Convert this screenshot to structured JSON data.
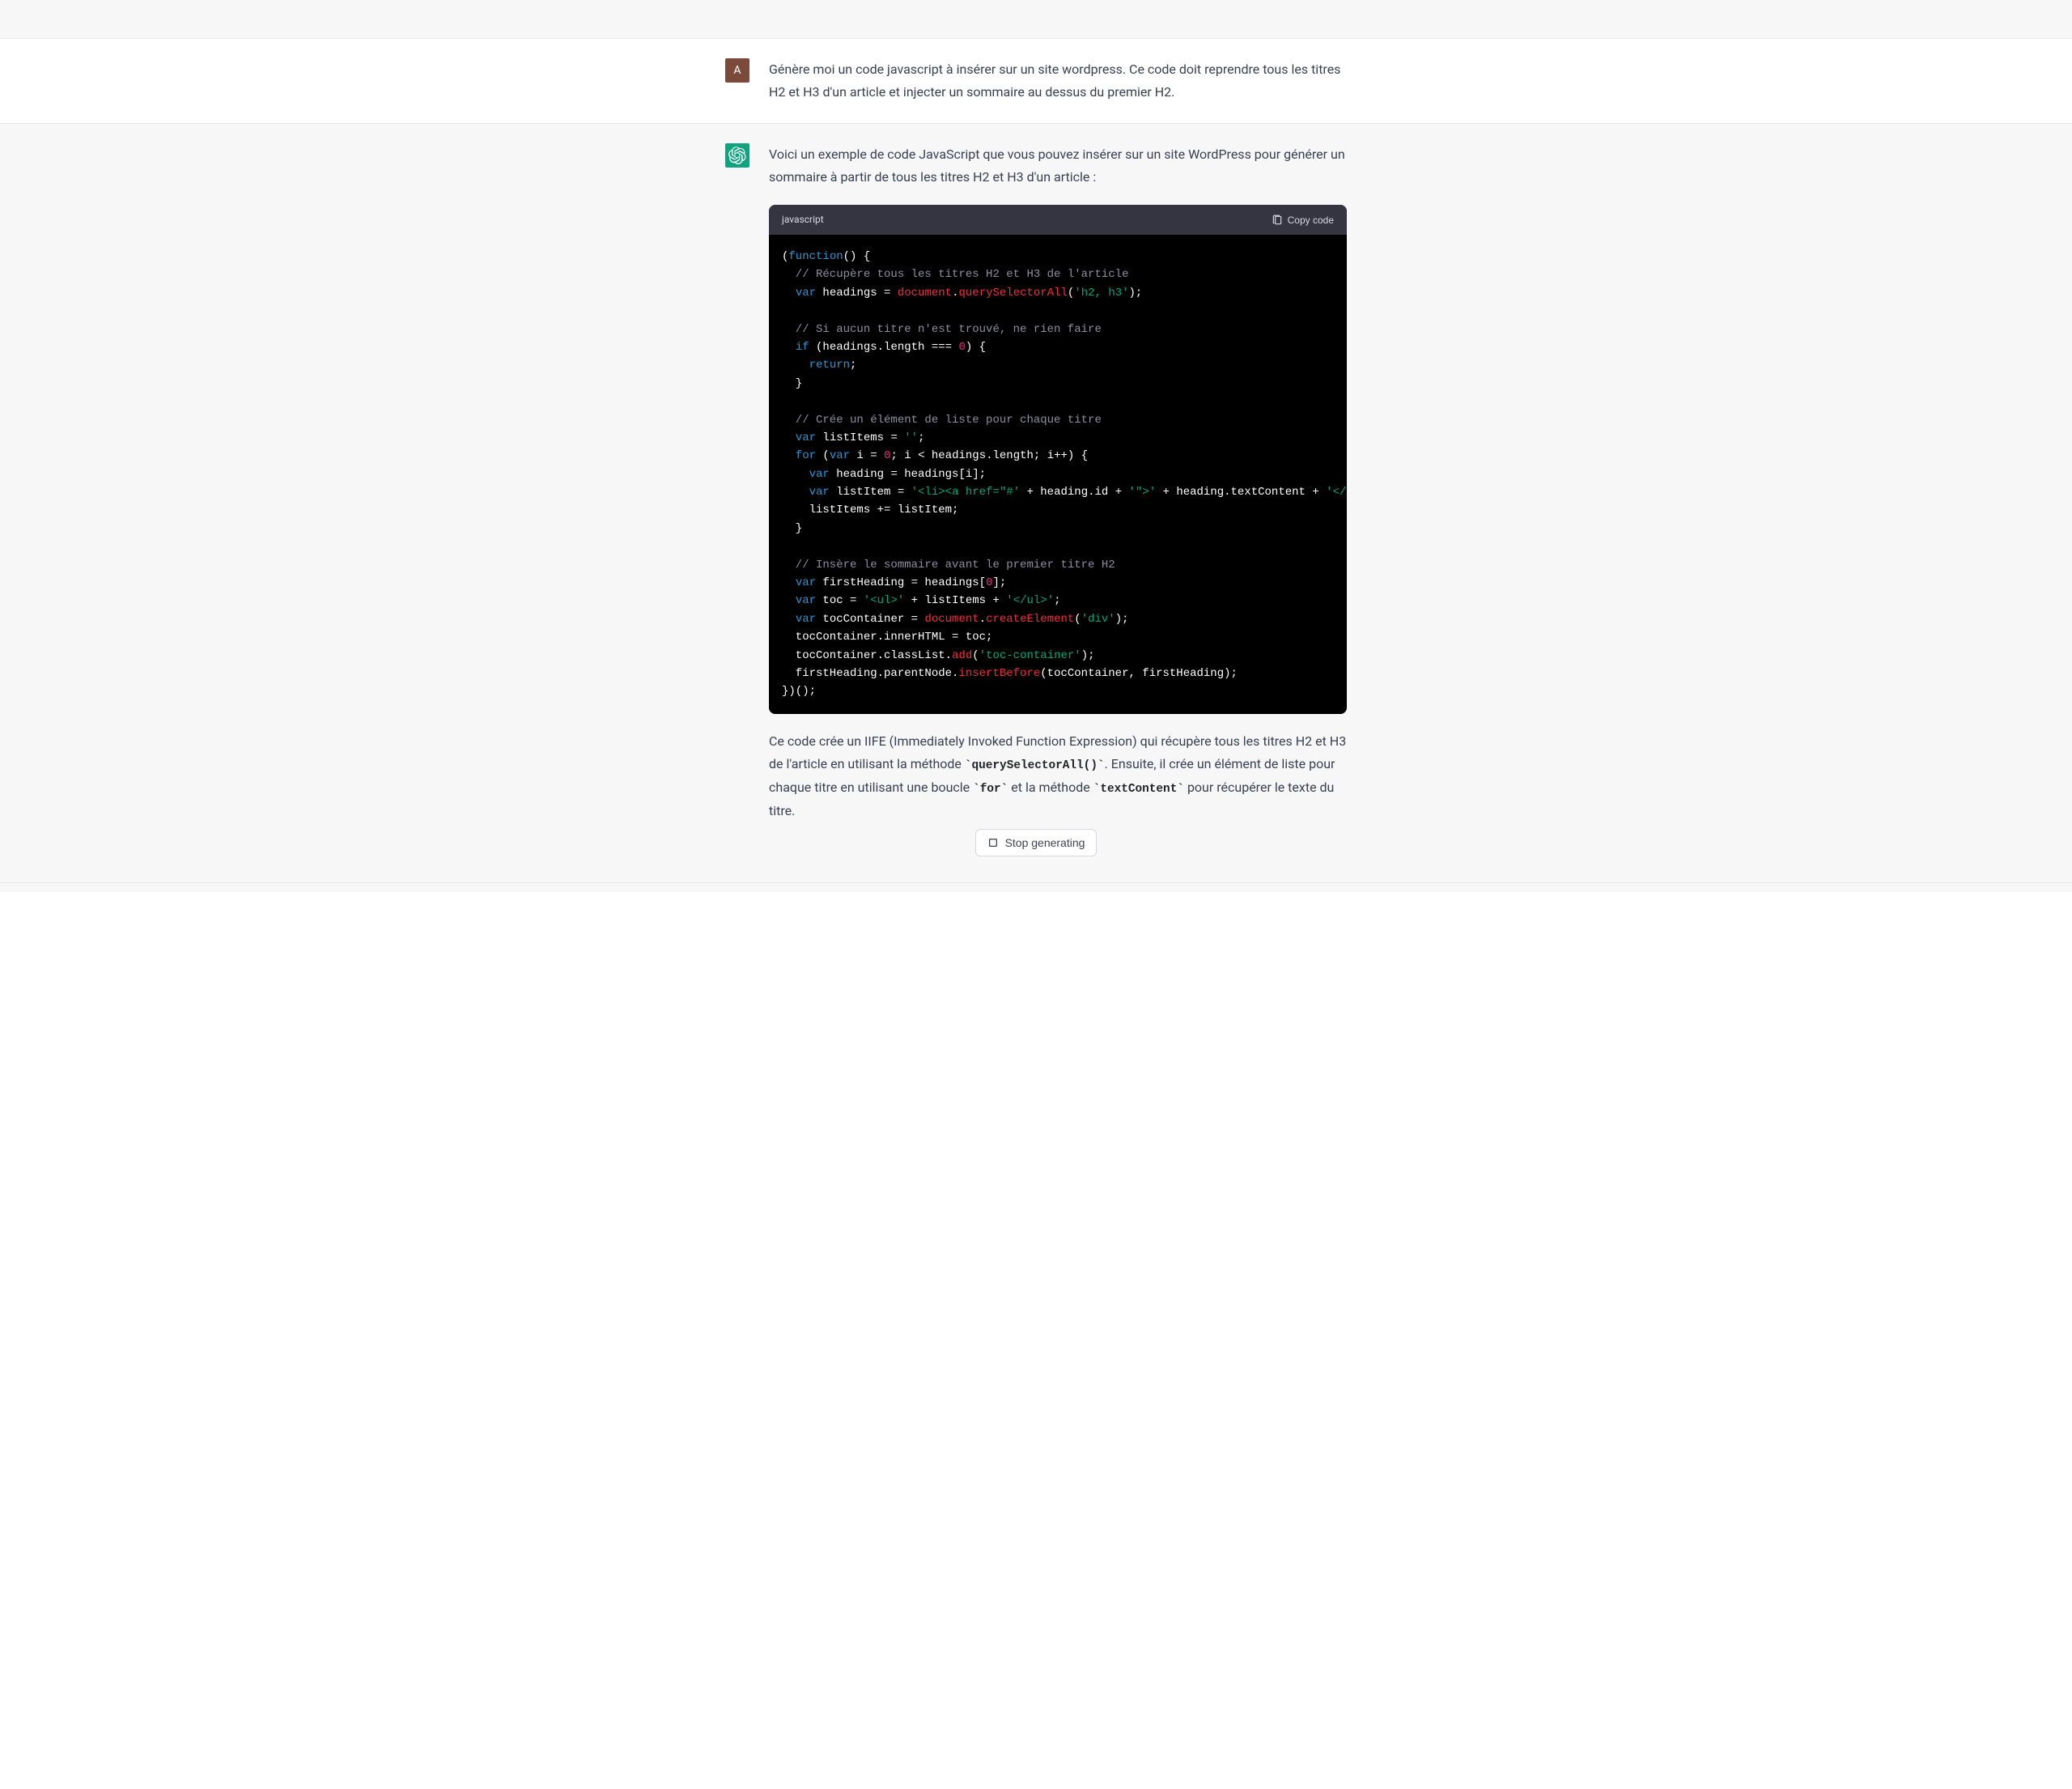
{
  "user": {
    "avatar_letter": "A",
    "message": "Génère moi un code javascript à insérer sur un site wordpress. Ce code doit reprendre tous les titres H2 et H3 d'un article et injecter un sommaire au dessus du premier H2."
  },
  "assistant": {
    "intro": "Voici un exemple de code JavaScript que vous pouvez insérer sur un site WordPress pour générer un sommaire à partir de tous les titres H2 et H3 d'un article :",
    "code_block": {
      "language": "javascript",
      "copy_label": "Copy code",
      "tokens": [
        [
          "wh",
          "("
        ],
        [
          "kw",
          "function"
        ],
        [
          "wh",
          "() {\n"
        ],
        [
          "cm",
          "  // Récupère tous les titres H2 et H3 de l'article"
        ],
        [
          "wh",
          "\n"
        ],
        [
          "wh",
          "  "
        ],
        [
          "kw",
          "var"
        ],
        [
          "wh",
          " headings = "
        ],
        [
          "fn",
          "document"
        ],
        [
          "wh",
          "."
        ],
        [
          "fn",
          "querySelectorAll"
        ],
        [
          "wh",
          "("
        ],
        [
          "str",
          "'h2, h3'"
        ],
        [
          "wh",
          ");\n"
        ],
        [
          "wh",
          "\n"
        ],
        [
          "cm",
          "  // Si aucun titre n'est trouvé, ne rien faire"
        ],
        [
          "wh",
          "\n"
        ],
        [
          "wh",
          "  "
        ],
        [
          "kw",
          "if"
        ],
        [
          "wh",
          " (headings.length === "
        ],
        [
          "num",
          "0"
        ],
        [
          "wh",
          ") {\n"
        ],
        [
          "wh",
          "    "
        ],
        [
          "kw",
          "return"
        ],
        [
          "wh",
          ";\n"
        ],
        [
          "wh",
          "  }\n"
        ],
        [
          "wh",
          "\n"
        ],
        [
          "cm",
          "  // Crée un élément de liste pour chaque titre"
        ],
        [
          "wh",
          "\n"
        ],
        [
          "wh",
          "  "
        ],
        [
          "kw",
          "var"
        ],
        [
          "wh",
          " listItems = "
        ],
        [
          "str",
          "''"
        ],
        [
          "wh",
          ";\n"
        ],
        [
          "wh",
          "  "
        ],
        [
          "kw",
          "for"
        ],
        [
          "wh",
          " ("
        ],
        [
          "kw",
          "var"
        ],
        [
          "wh",
          " i = "
        ],
        [
          "num",
          "0"
        ],
        [
          "wh",
          "; i < headings.length; i++) {\n"
        ],
        [
          "wh",
          "    "
        ],
        [
          "kw",
          "var"
        ],
        [
          "wh",
          " heading = headings[i];\n"
        ],
        [
          "wh",
          "    "
        ],
        [
          "kw",
          "var"
        ],
        [
          "wh",
          " listItem = "
        ],
        [
          "str",
          "'<li><a href=\"#'"
        ],
        [
          "wh",
          " + heading.id + "
        ],
        [
          "str",
          "'\">'"
        ],
        [
          "wh",
          " + heading.textContent + "
        ],
        [
          "str",
          "'</a></li>'"
        ],
        [
          "wh",
          ";\n"
        ],
        [
          "wh",
          "    listItems += listItem;\n"
        ],
        [
          "wh",
          "  }\n"
        ],
        [
          "wh",
          "\n"
        ],
        [
          "cm",
          "  // Insère le sommaire avant le premier titre H2"
        ],
        [
          "wh",
          "\n"
        ],
        [
          "wh",
          "  "
        ],
        [
          "kw",
          "var"
        ],
        [
          "wh",
          " firstHeading = headings["
        ],
        [
          "num",
          "0"
        ],
        [
          "wh",
          "];\n"
        ],
        [
          "wh",
          "  "
        ],
        [
          "kw",
          "var"
        ],
        [
          "wh",
          " toc = "
        ],
        [
          "str",
          "'<ul>'"
        ],
        [
          "wh",
          " + listItems + "
        ],
        [
          "str",
          "'</ul>'"
        ],
        [
          "wh",
          ";\n"
        ],
        [
          "wh",
          "  "
        ],
        [
          "kw",
          "var"
        ],
        [
          "wh",
          " tocContainer = "
        ],
        [
          "fn",
          "document"
        ],
        [
          "wh",
          "."
        ],
        [
          "fn",
          "createElement"
        ],
        [
          "wh",
          "("
        ],
        [
          "str",
          "'div'"
        ],
        [
          "wh",
          ");\n"
        ],
        [
          "wh",
          "  tocContainer.innerHTML = toc;\n"
        ],
        [
          "wh",
          "  tocContainer.classList."
        ],
        [
          "fn",
          "add"
        ],
        [
          "wh",
          "("
        ],
        [
          "str",
          "'toc-container'"
        ],
        [
          "wh",
          ");\n"
        ],
        [
          "wh",
          "  firstHeading.parentNode."
        ],
        [
          "fn",
          "insertBefore"
        ],
        [
          "wh",
          "(tocContainer, firstHeading);\n"
        ],
        [
          "wh",
          "})();"
        ]
      ]
    },
    "explanation": {
      "part1": "Ce code crée un IIFE (Immediately Invoked Function Expression) qui récupère tous les titres H2 et H3 de l'article en utilisant la méthode ",
      "code1": "`querySelectorAll()`",
      "part2": ". Ensuite, il crée un élément de liste pour chaque titre en utilisant une boucle ",
      "code2": "`for`",
      "part3": " et la méthode ",
      "code3": "`textContent`",
      "part4": " pour récupérer le texte du titre."
    }
  },
  "footer": {
    "stop_label": "Stop generating"
  }
}
